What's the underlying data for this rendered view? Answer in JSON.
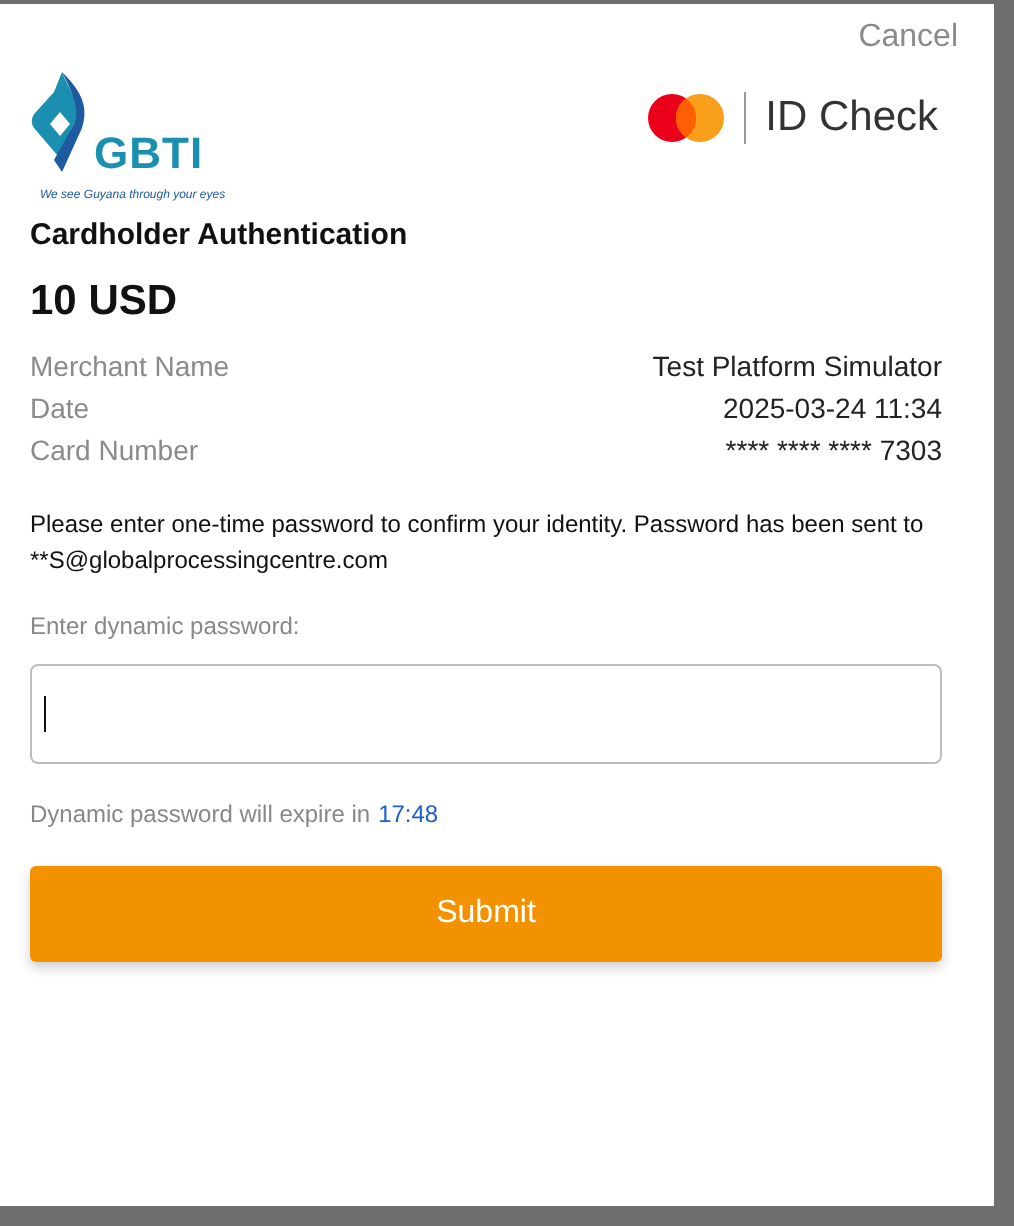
{
  "cancel": "Cancel",
  "bank_logo": {
    "name": "GBTI",
    "tagline": "We see Guyana through your eyes"
  },
  "scheme_logo": {
    "label": "ID Check"
  },
  "title": "Cardholder Authentication",
  "amount": "10 USD",
  "details": [
    {
      "label": "Merchant Name",
      "value": "Test Platform Simulator"
    },
    {
      "label": "Date",
      "value": "2025-03-24 11:34"
    },
    {
      "label": "Card Number",
      "value": "**** **** **** 7303"
    }
  ],
  "instructions": "Please enter one-time password to confirm your identity. Password has been sent to **S@globalprocessingcentre.com",
  "password_field": {
    "label": "Enter dynamic password:",
    "focused": true
  },
  "expiry": {
    "text": "Dynamic password will expire in",
    "time": "17:48"
  },
  "submit": "Submit"
}
